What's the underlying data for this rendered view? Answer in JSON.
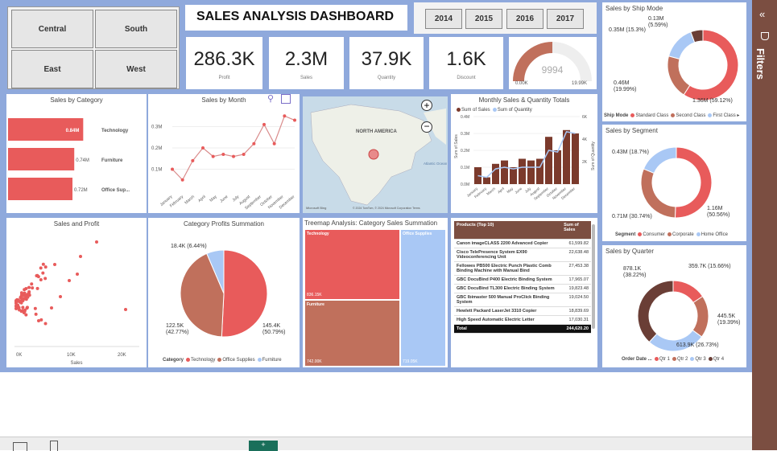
{
  "regions": [
    "Central",
    "South",
    "East",
    "West"
  ],
  "title": "SALES ANALYSIS DASHBOARD",
  "years": [
    "2014",
    "2015",
    "2016",
    "2017"
  ],
  "kpis": [
    {
      "value": "286.3K",
      "label": "Profit"
    },
    {
      "value": "2.3M",
      "label": "Sales"
    },
    {
      "value": "37.9K",
      "label": "Quantity"
    },
    {
      "value": "1.6K",
      "label": "Discount"
    }
  ],
  "gauge": {
    "value": "9994",
    "min": "0.00K",
    "max": "19.99K",
    "fraction": 0.5
  },
  "sales_by_category": {
    "title": "Sales by Category",
    "items": [
      {
        "name": "Technology",
        "label": "0.84M",
        "value": 0.84
      },
      {
        "name": "Furniture",
        "label": "0.74M",
        "value": 0.74
      },
      {
        "name": "Office Sup...",
        "label": "0.72M",
        "value": 0.72
      }
    ]
  },
  "sales_by_month": {
    "title": "Sales by Month",
    "ticks": [
      "0.3M",
      "0.2M",
      "0.1M"
    ],
    "months": [
      "January",
      "February",
      "March",
      "April",
      "May",
      "June",
      "July",
      "August",
      "September",
      "October",
      "November",
      "December"
    ],
    "values": [
      0.1,
      0.05,
      0.14,
      0.2,
      0.16,
      0.17,
      0.16,
      0.17,
      0.22,
      0.31,
      0.22,
      0.35,
      0.33
    ],
    "icons": {
      "filter": "filter-icon",
      "focus": "focus-icon",
      "more": "more-icon"
    }
  },
  "map": {
    "label": "NORTH AMERICA",
    "credit": "Microsoft Bing",
    "copyright": "© 2024 TomTom, © 2024 Microsoft Corporation Terms",
    "ocean": "Atlantic Ocean"
  },
  "monthly": {
    "title": "Monthly Sales & Quantity Totals",
    "legend": [
      "Sum of Sales",
      "Sum of Quantity"
    ],
    "yleft": [
      "0.4M",
      "0.3M",
      "0.2M",
      "0.1M",
      "0.0M"
    ],
    "yright": [
      "6K",
      "4K",
      "2K"
    ],
    "ylabel_left": "Sum of Sales",
    "ylabel_right": "Sum of Quantity",
    "bars": [
      0.1,
      0.04,
      0.12,
      0.14,
      0.1,
      0.15,
      0.14,
      0.15,
      0.28,
      0.2,
      0.32,
      0.3
    ],
    "line": [
      0.05,
      0.04,
      0.09,
      0.1,
      0.09,
      0.1,
      0.1,
      0.1,
      0.2,
      0.19,
      0.31,
      0.3
    ]
  },
  "ship_mode": {
    "title": "Sales by Ship Mode",
    "labels": [
      "0.13M\n(5.59%)",
      "0.35M (15.3%)",
      "0.46M\n(19.99%)",
      "1.36M (59.12%)"
    ],
    "legend_title": "Ship Mode",
    "legend": [
      "Standard Class",
      "Second Class",
      "First Class"
    ],
    "slices": [
      {
        "v": 59.12,
        "c": "#e85b5b"
      },
      {
        "v": 19.99,
        "c": "#c0705c"
      },
      {
        "v": 15.3,
        "c": "#a9c8f5"
      },
      {
        "v": 5.59,
        "c": "#6a3e36"
      }
    ]
  },
  "segment": {
    "title": "Sales by Segment",
    "labels": [
      "0.43M (18.7%)",
      "1.16M\n(50.56%)",
      "0.71M (30.74%)"
    ],
    "legend_title": "Segment",
    "legend": [
      "Consumer",
      "Corporate",
      "Home Office"
    ],
    "slices": [
      {
        "v": 50.56,
        "c": "#e85b5b"
      },
      {
        "v": 30.74,
        "c": "#c0705c"
      },
      {
        "v": 18.7,
        "c": "#a9c8f5"
      }
    ]
  },
  "quarter": {
    "title": "Sales by Quarter",
    "labels": [
      "878.1K\n(38.22%)",
      "359.7K (15.66%)",
      "445.5K\n(19.39%)",
      "613.9K (26.73%)"
    ],
    "legend_title": "Order Date ...",
    "legend": [
      "Qtr 1",
      "Qtr 2",
      "Qtr 3",
      "Qtr 4"
    ],
    "slices": [
      {
        "v": 15.66,
        "c": "#e85b5b"
      },
      {
        "v": 19.39,
        "c": "#c0705c"
      },
      {
        "v": 26.73,
        "c": "#a9c8f5"
      },
      {
        "v": 38.22,
        "c": "#6a3e36"
      }
    ]
  },
  "scatter": {
    "title": "Sales and Profit",
    "xlabel": "Sales",
    "xticks": [
      "0K",
      "10K",
      "20K"
    ]
  },
  "cat_profit": {
    "title": "Category Profits Summation",
    "labels": [
      "18.4K (6.44%)",
      "122.5K\n(42.77%)",
      "145.4K\n(50.79%)"
    ],
    "legend_title": "Category",
    "legend": [
      "Technology",
      "Office Supplies",
      "Furniture"
    ],
    "slices": [
      {
        "v": 50.79,
        "c": "#e85b5b"
      },
      {
        "v": 42.77,
        "c": "#c0705c"
      },
      {
        "v": 6.44,
        "c": "#a9c8f5"
      }
    ]
  },
  "treemap": {
    "title": "Treemap Analysis: Category Sales Summation",
    "tiles": [
      {
        "name": "Technology",
        "value": "836.15K"
      },
      {
        "name": "Furniture",
        "value": "742.00K"
      },
      {
        "name": "Office Supplies",
        "value": "719.05K"
      }
    ]
  },
  "products": {
    "header": [
      "Products (Top 10)",
      "Sum of Sales"
    ],
    "rows": [
      [
        "Canon imageCLASS 2200 Advanced Copier",
        "61,599.82"
      ],
      [
        "Cisco TelePresence System EX90 Videoconferencing Unit",
        "22,638.48"
      ],
      [
        "Fellowes PB500 Electric Punch Plastic Comb Binding Machine with Manual Bind",
        "27,453.38"
      ],
      [
        "GBC DocuBind P400 Electric Binding System",
        "17,965.07"
      ],
      [
        "GBC DocuBind TL300 Electric Binding System",
        "19,823.48"
      ],
      [
        "GBC Ibimaster 500 Manual ProClick Binding System",
        "19,024.50"
      ],
      [
        "Hewlett Packard LaserJet 3310 Copier",
        "18,839.69"
      ],
      [
        "High Speed Automatic Electric Letter",
        "17,030.31"
      ]
    ],
    "total": [
      "Total",
      "244,620.20"
    ]
  },
  "filters": {
    "label": "Filters"
  }
}
